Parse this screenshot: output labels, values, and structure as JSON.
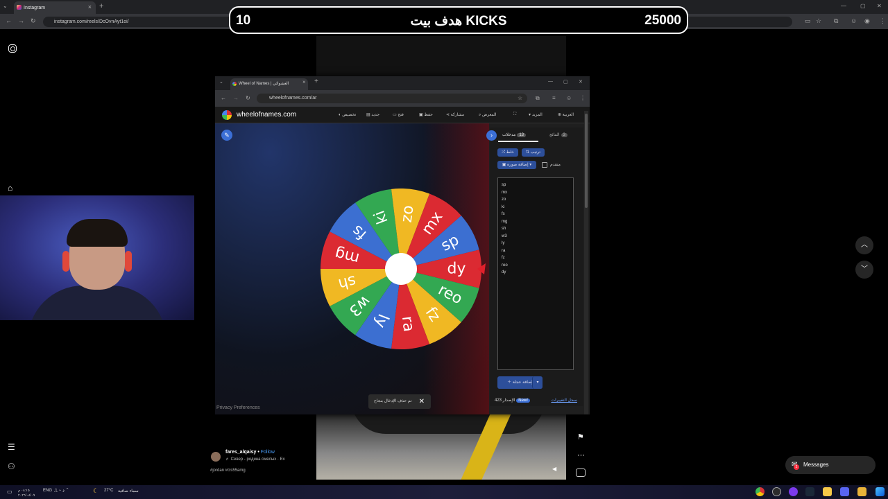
{
  "outer_browser": {
    "tab_title": "Instagram",
    "url": "instagram.com/reels/DcOvnAyt1oi/"
  },
  "banner": {
    "left_number": "10",
    "center_text": "هدف بيت KICKS",
    "right_number": "25000"
  },
  "inner_browser": {
    "tab_title": "Wheel of Names | العشوائي",
    "url": "wheelofnames.com/ar"
  },
  "site": {
    "logo_text": "wheelofnames.com",
    "menu": [
      "تخصيص",
      "جديد",
      "فتح",
      "حفظ",
      "مشاركة",
      "المعرض",
      "المزيد",
      "العربية"
    ]
  },
  "wheel": {
    "segments": [
      "sp",
      "mx",
      "zo",
      "ki",
      "fs",
      "mg",
      "sh",
      "w3",
      "ly",
      "ra",
      "fz",
      "reo",
      "dy"
    ],
    "colors": [
      "#3c6fd1",
      "#db2a32",
      "#f0b823",
      "#33a852",
      "#3c6fd1",
      "#db2a32",
      "#f0b823",
      "#33a852",
      "#3c6fd1",
      "#db2a32",
      "#f0b823",
      "#33a852",
      "#db2a32"
    ],
    "pointer_color": "#e0202b"
  },
  "panel": {
    "tab_entries_label": "مدخلات",
    "tab_entries_count": "13",
    "tab_results_label": "النتائج",
    "tab_results_count": "3",
    "shuffle_label": "خلط",
    "sort_label": "ترتيب",
    "add_image_label": "إضافة صورة",
    "advanced_label": "متقدم",
    "entries": [
      "sp",
      "mx",
      "zo",
      "ki",
      "fs",
      "mg",
      "sh",
      "w3",
      "ly",
      "ra",
      "fz",
      "reo",
      "dy"
    ],
    "add_button_label": "إضافة عجلة",
    "version_label": "الإصدار 423",
    "new_badge": "New!",
    "changelog_link": "سجل التغييرات"
  },
  "privacy_link": "Privacy Preferences",
  "toast": {
    "text": "تم حذف الإدخال بنجاح"
  },
  "instagram": {
    "username": "fares_alqaisy",
    "follow_label": "Follow",
    "audio": "♬ Север - родина смелых · Ex",
    "hashtags": "#jordan #cls55amg",
    "messages_label": "Messages",
    "messages_badge": "2"
  },
  "taskbar": {
    "weather_temp": "27°C",
    "weather_text": "سماء صافية",
    "lang": "ENG",
    "time": "٠٨:١٥ م",
    "date": "٢٠٢٦/٠٨/٠٩"
  }
}
